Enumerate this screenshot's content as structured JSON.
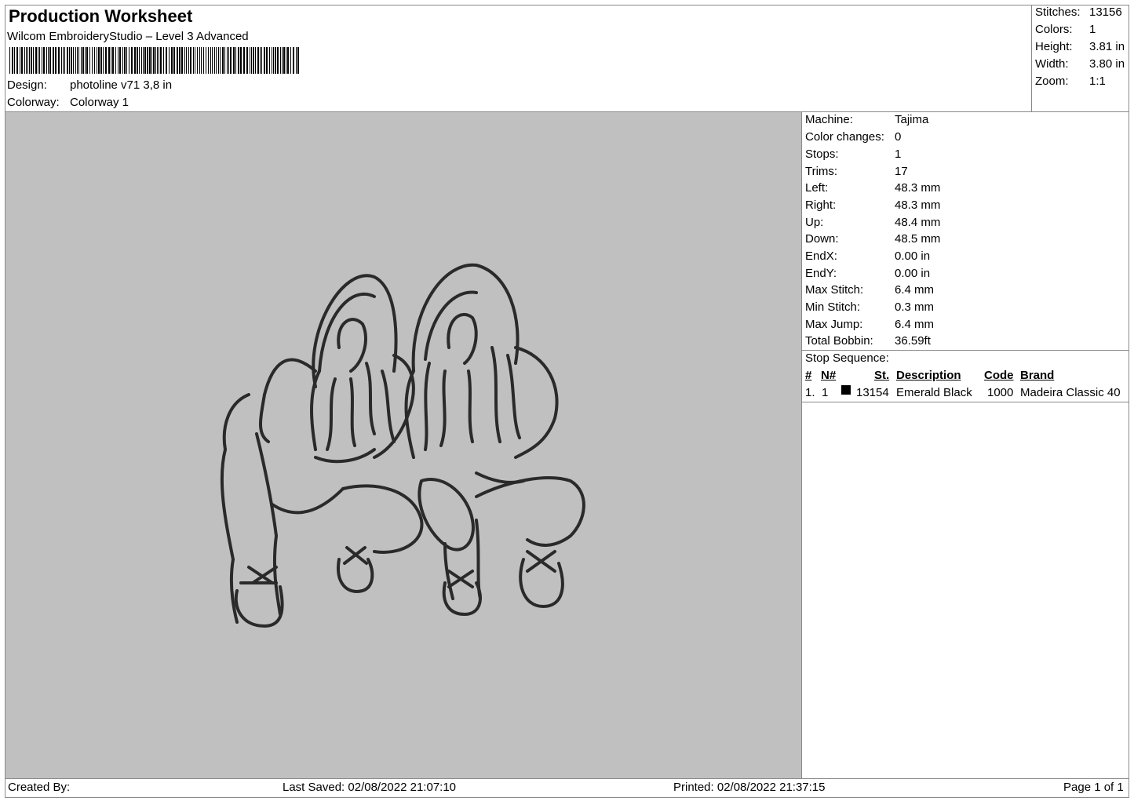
{
  "header": {
    "title": "Production Worksheet",
    "subtitle": "Wilcom EmbroideryStudio – Level 3 Advanced",
    "design_label": "Design:",
    "design_value": "photoline v71 3,8 in",
    "colorway_label": "Colorway:",
    "colorway_value": "Colorway 1"
  },
  "stats": [
    {
      "label": "Stitches:",
      "value": "13156"
    },
    {
      "label": "Colors:",
      "value": "1"
    },
    {
      "label": "Height:",
      "value": "3.81 in"
    },
    {
      "label": "Width:",
      "value": "3.80 in"
    },
    {
      "label": "Zoom:",
      "value": "1:1"
    }
  ],
  "machine_info": [
    {
      "label": "Machine:",
      "value": "Tajima"
    },
    {
      "label": "Color changes:",
      "value": "0"
    },
    {
      "label": "Stops:",
      "value": "1"
    },
    {
      "label": "Trims:",
      "value": "17"
    },
    {
      "label": "Left:",
      "value": "48.3 mm"
    },
    {
      "label": "Right:",
      "value": "48.3 mm"
    },
    {
      "label": "Up:",
      "value": "48.4 mm"
    },
    {
      "label": "Down:",
      "value": "48.5 mm"
    },
    {
      "label": "EndX:",
      "value": "0.00 in"
    },
    {
      "label": "EndY:",
      "value": "0.00 in"
    },
    {
      "label": "Max Stitch:",
      "value": "6.4 mm"
    },
    {
      "label": "Min Stitch:",
      "value": "0.3 mm"
    },
    {
      "label": "Max Jump:",
      "value": "6.4 mm"
    },
    {
      "label": "Total Bobbin:",
      "value": "36.59ft"
    }
  ],
  "stop_sequence": {
    "title": "Stop Sequence:",
    "headers": {
      "num": "#",
      "n": "N#",
      "st": "St.",
      "description": "Description",
      "code": "Code",
      "brand": "Brand"
    },
    "rows": [
      {
        "num": "1.",
        "n": "1",
        "color": "#000000",
        "st": "13154",
        "description": "Emerald Black",
        "code": "1000",
        "brand": "Madeira Classic 40"
      }
    ]
  },
  "footer": {
    "created_by": "Created By:",
    "last_saved": "Last Saved: 02/08/2022 21:07:10",
    "printed": "Printed: 02/08/2022 21:37:15",
    "page": "Page 1 of 1"
  },
  "colors": {
    "preview_bg": "#c0c0c0",
    "thread": "#2a2a2a"
  }
}
